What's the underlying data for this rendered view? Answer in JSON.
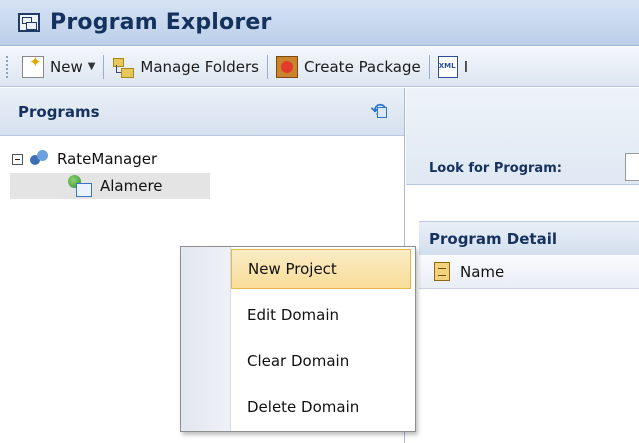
{
  "window": {
    "title": "Program Explorer",
    "icon": "window-icon"
  },
  "toolbar": {
    "new_label": "New",
    "manage_folders_label": "Manage Folders",
    "create_package_label": "Create Package",
    "partial_label": "I"
  },
  "left_panel": {
    "title": "Programs",
    "tree": {
      "root_label": "RateManager",
      "child_label": "Alamere"
    }
  },
  "right_panel": {
    "search_label": "Look for Program:",
    "detail_title": "Program Detail",
    "column_name": "Name"
  },
  "context_menu": {
    "items": [
      {
        "label": "New Project",
        "highlighted": true
      },
      {
        "label": "Edit Domain",
        "highlighted": false
      },
      {
        "label": "Clear Domain",
        "highlighted": false
      },
      {
        "label": "Delete Domain",
        "highlighted": false
      }
    ]
  },
  "colors": {
    "title_text": "#15325f",
    "highlight": "#f8dc98"
  }
}
